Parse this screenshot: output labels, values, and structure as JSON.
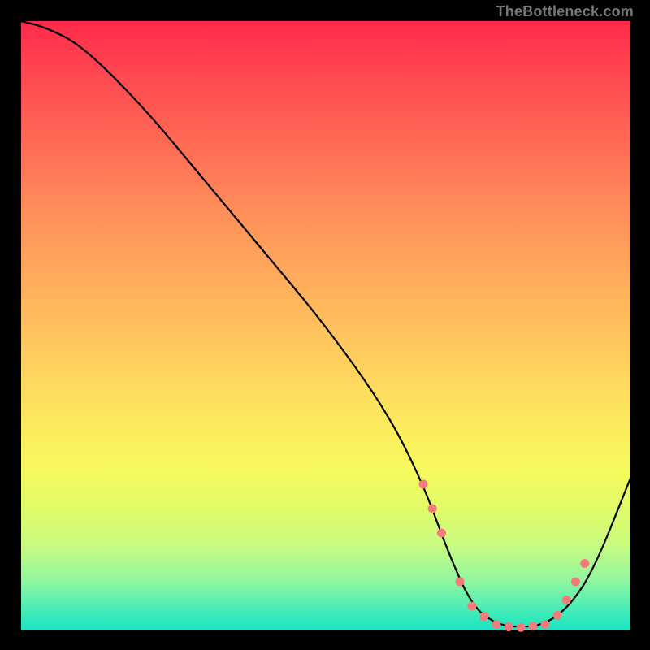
{
  "watermark": "TheBottleneck.com",
  "chart_data": {
    "type": "line",
    "title": "",
    "xlabel": "",
    "ylabel": "",
    "xlim": [
      0,
      100
    ],
    "ylim": [
      0,
      100
    ],
    "series": [
      {
        "name": "bottleneck-curve",
        "x": [
          0,
          4,
          10,
          20,
          30,
          40,
          50,
          60,
          66,
          70,
          74,
          78,
          82,
          86,
          90,
          94,
          100
        ],
        "values": [
          100,
          99,
          96,
          86,
          74,
          62,
          50,
          36,
          24,
          13,
          4,
          1,
          0.5,
          1,
          4,
          10,
          25
        ]
      }
    ],
    "markers": {
      "name": "highlight-dots",
      "color": "#f37b7b",
      "radius": 5.5,
      "x": [
        66,
        67.5,
        69,
        72,
        74,
        76,
        78,
        80,
        82,
        84,
        86,
        88,
        89.5,
        91,
        92.5
      ],
      "values": [
        24,
        20,
        16,
        8,
        4,
        2.3,
        1,
        0.6,
        0.5,
        0.7,
        1,
        2.5,
        5,
        8,
        11
      ]
    },
    "colors": {
      "curve": "#000000",
      "marker": "#f37b7b"
    }
  }
}
